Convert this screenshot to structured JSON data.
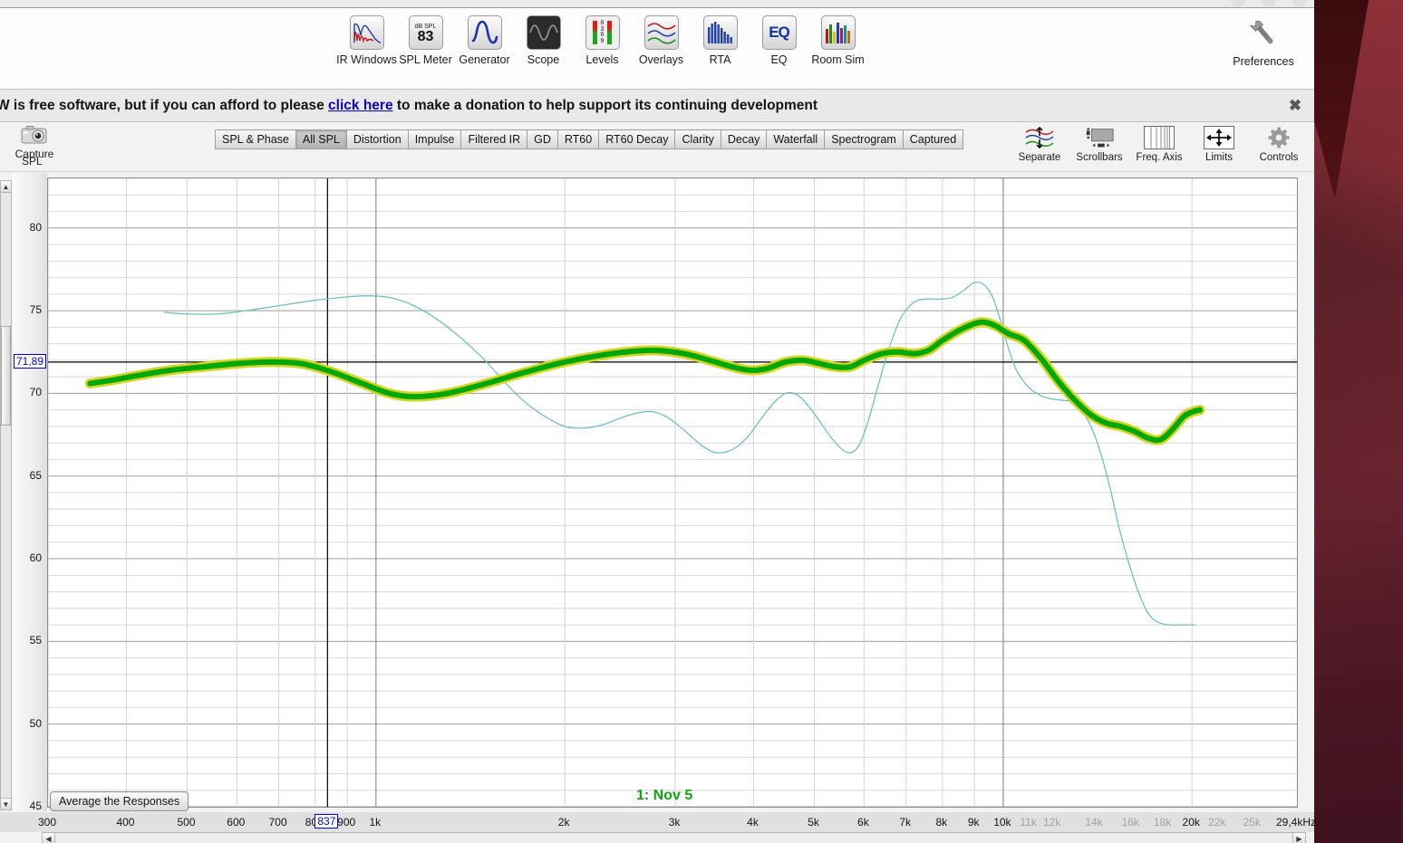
{
  "window": {
    "buttons": [
      "minimize",
      "maximize",
      "close"
    ]
  },
  "toolbar": {
    "items": [
      {
        "label": "IR Windows",
        "icon": "ir-windows-icon"
      },
      {
        "label": "SPL Meter",
        "icon": "spl-meter-icon",
        "value": "83",
        "unit": "dB SPL"
      },
      {
        "label": "Generator",
        "icon": "generator-icon"
      },
      {
        "label": "Scope",
        "icon": "scope-icon"
      },
      {
        "label": "Levels",
        "icon": "levels-icon",
        "scale": "0369"
      },
      {
        "label": "Overlays",
        "icon": "overlays-icon"
      },
      {
        "label": "RTA",
        "icon": "rta-icon"
      },
      {
        "label": "EQ",
        "icon": "eq-icon",
        "glyph": "EQ"
      },
      {
        "label": "Room Sim",
        "icon": "room-sim-icon"
      }
    ],
    "preferences": {
      "label": "Preferences",
      "icon": "wrench-icon"
    }
  },
  "banner": {
    "text_before": "W is free software, but if you can afford to please ",
    "link": "click here",
    "text_after": " to make a donation to help support its continuing development",
    "close": "✖"
  },
  "capture": {
    "label": "Capture",
    "icon": "camera-icon",
    "axis_label": "SPL"
  },
  "tabs": [
    {
      "label": "SPL & Phase",
      "active": false
    },
    {
      "label": "All SPL",
      "active": true
    },
    {
      "label": "Distortion",
      "active": false
    },
    {
      "label": "Impulse",
      "active": false
    },
    {
      "label": "Filtered IR",
      "active": false
    },
    {
      "label": "GD",
      "active": false
    },
    {
      "label": "RT60",
      "active": false
    },
    {
      "label": "RT60 Decay",
      "active": false
    },
    {
      "label": "Clarity",
      "active": false
    },
    {
      "label": "Decay",
      "active": false
    },
    {
      "label": "Waterfall",
      "active": false
    },
    {
      "label": "Spectrogram",
      "active": false
    },
    {
      "label": "Captured",
      "active": false
    }
  ],
  "right_tools": [
    {
      "label": "Separate",
      "icon": "separate-traces-icon"
    },
    {
      "label": "Scrollbars",
      "icon": "scrollbars-icon"
    },
    {
      "label": "Freq. Axis",
      "icon": "freq-axis-icon"
    },
    {
      "label": "Limits",
      "icon": "limits-icon"
    },
    {
      "label": "Controls",
      "icon": "controls-gear-icon"
    }
  ],
  "graph": {
    "average_button": "Average the Responses",
    "legend": "1: Nov 5",
    "cursor": {
      "y_value": "71,89",
      "x_value": "837"
    }
  },
  "chart_data": {
    "type": "line",
    "title": "",
    "xlabel": "",
    "ylabel": "SPL",
    "x_scale": "log",
    "xlim": [
      300,
      29400
    ],
    "ylim": [
      45,
      83
    ],
    "grid": true,
    "legend_position": "inside-bottom",
    "cursor_line_hz": 837,
    "cursor_line_db": 71.89,
    "y_ticks": [
      45,
      50,
      55,
      60,
      65,
      70,
      75,
      80
    ],
    "x_ticks": [
      {
        "label": "300",
        "hz": 300,
        "minor": false
      },
      {
        "label": "400",
        "hz": 400,
        "minor": false
      },
      {
        "label": "500",
        "hz": 500,
        "minor": false
      },
      {
        "label": "600",
        "hz": 600,
        "minor": false
      },
      {
        "label": "700",
        "hz": 700,
        "minor": false
      },
      {
        "label": "800",
        "hz": 800,
        "minor": false
      },
      {
        "label": "900",
        "hz": 900,
        "minor": false
      },
      {
        "label": "1k",
        "hz": 1000,
        "minor": false
      },
      {
        "label": "2k",
        "hz": 2000,
        "minor": false
      },
      {
        "label": "3k",
        "hz": 3000,
        "minor": false
      },
      {
        "label": "4k",
        "hz": 4000,
        "minor": false
      },
      {
        "label": "5k",
        "hz": 5000,
        "minor": false
      },
      {
        "label": "6k",
        "hz": 6000,
        "minor": false
      },
      {
        "label": "7k",
        "hz": 7000,
        "minor": false
      },
      {
        "label": "8k",
        "hz": 8000,
        "minor": false
      },
      {
        "label": "9k",
        "hz": 9000,
        "minor": false
      },
      {
        "label": "10k",
        "hz": 10000,
        "minor": false
      },
      {
        "label": "11k",
        "hz": 11000,
        "minor": true
      },
      {
        "label": "12k",
        "hz": 12000,
        "minor": true
      },
      {
        "label": "14k",
        "hz": 14000,
        "minor": true
      },
      {
        "label": "16k",
        "hz": 16000,
        "minor": true
      },
      {
        "label": "18k",
        "hz": 18000,
        "minor": true
      },
      {
        "label": "20k",
        "hz": 20000,
        "minor": false
      },
      {
        "label": "22k",
        "hz": 22000,
        "minor": true
      },
      {
        "label": "25k",
        "hz": 25000,
        "minor": true
      },
      {
        "label": "29,4kHz",
        "hz": 29400,
        "minor": false
      }
    ],
    "series": [
      {
        "name": "1: Nov 5",
        "color": "#00a806",
        "halo_color": "#d6d41e",
        "width": 6,
        "points": [
          [
            350,
            70.6
          ],
          [
            380,
            70.8
          ],
          [
            420,
            71.1
          ],
          [
            470,
            71.4
          ],
          [
            530,
            71.6
          ],
          [
            600,
            71.8
          ],
          [
            680,
            71.9
          ],
          [
            760,
            71.8
          ],
          [
            850,
            71.3
          ],
          [
            950,
            70.6
          ],
          [
            1050,
            70.0
          ],
          [
            1150,
            69.8
          ],
          [
            1300,
            70.0
          ],
          [
            1500,
            70.6
          ],
          [
            1700,
            71.2
          ],
          [
            1950,
            71.8
          ],
          [
            2200,
            72.2
          ],
          [
            2500,
            72.5
          ],
          [
            2800,
            72.6
          ],
          [
            3100,
            72.4
          ],
          [
            3400,
            72.0
          ],
          [
            3700,
            71.6
          ],
          [
            3950,
            71.4
          ],
          [
            4200,
            71.5
          ],
          [
            4500,
            71.9
          ],
          [
            4800,
            72.0
          ],
          [
            5100,
            71.8
          ],
          [
            5400,
            71.6
          ],
          [
            5700,
            71.6
          ],
          [
            6000,
            72.0
          ],
          [
            6400,
            72.4
          ],
          [
            6800,
            72.5
          ],
          [
            7200,
            72.4
          ],
          [
            7600,
            72.6
          ],
          [
            8000,
            73.2
          ],
          [
            8600,
            73.9
          ],
          [
            9200,
            74.3
          ],
          [
            9700,
            74.1
          ],
          [
            10200,
            73.6
          ],
          [
            10800,
            73.2
          ],
          [
            11500,
            72.1
          ],
          [
            12200,
            70.8
          ],
          [
            13000,
            69.6
          ],
          [
            13800,
            68.7
          ],
          [
            14600,
            68.2
          ],
          [
            15400,
            68.0
          ],
          [
            16200,
            67.7
          ],
          [
            17000,
            67.3
          ],
          [
            17800,
            67.2
          ],
          [
            18600,
            67.8
          ],
          [
            19400,
            68.6
          ],
          [
            20100,
            68.9
          ],
          [
            20600,
            69.0
          ]
        ]
      },
      {
        "name": "measurement-trace",
        "color": "#6ec0c4",
        "width": 1.3,
        "points": [
          [
            460,
            74.9
          ],
          [
            500,
            74.8
          ],
          [
            560,
            74.8
          ],
          [
            620,
            75.0
          ],
          [
            700,
            75.3
          ],
          [
            790,
            75.6
          ],
          [
            880,
            75.8
          ],
          [
            960,
            75.9
          ],
          [
            1050,
            75.8
          ],
          [
            1150,
            75.3
          ],
          [
            1260,
            74.4
          ],
          [
            1380,
            73.2
          ],
          [
            1500,
            71.9
          ],
          [
            1620,
            70.5
          ],
          [
            1750,
            69.3
          ],
          [
            1880,
            68.5
          ],
          [
            2000,
            68.0
          ],
          [
            2150,
            67.9
          ],
          [
            2300,
            68.1
          ],
          [
            2450,
            68.5
          ],
          [
            2600,
            68.8
          ],
          [
            2750,
            68.9
          ],
          [
            2900,
            68.6
          ],
          [
            3050,
            68.0
          ],
          [
            3200,
            67.3
          ],
          [
            3350,
            66.7
          ],
          [
            3500,
            66.4
          ],
          [
            3700,
            66.6
          ],
          [
            3900,
            67.3
          ],
          [
            4100,
            68.4
          ],
          [
            4300,
            69.4
          ],
          [
            4500,
            70.0
          ],
          [
            4700,
            69.9
          ],
          [
            4900,
            69.2
          ],
          [
            5100,
            68.3
          ],
          [
            5300,
            67.4
          ],
          [
            5500,
            66.7
          ],
          [
            5700,
            66.4
          ],
          [
            5900,
            66.9
          ],
          [
            6100,
            68.4
          ],
          [
            6300,
            70.3
          ],
          [
            6500,
            72.1
          ],
          [
            6700,
            73.6
          ],
          [
            6900,
            74.7
          ],
          [
            7200,
            75.5
          ],
          [
            7500,
            75.7
          ],
          [
            7900,
            75.7
          ],
          [
            8300,
            75.8
          ],
          [
            8700,
            76.3
          ],
          [
            9000,
            76.7
          ],
          [
            9300,
            76.6
          ],
          [
            9600,
            75.9
          ],
          [
            9900,
            74.4
          ],
          [
            10200,
            72.7
          ],
          [
            10500,
            71.4
          ],
          [
            10900,
            70.5
          ],
          [
            11300,
            70.0
          ],
          [
            11800,
            69.7
          ],
          [
            12300,
            69.6
          ],
          [
            12800,
            69.5
          ],
          [
            13300,
            69.0
          ],
          [
            13800,
            68.0
          ],
          [
            14300,
            66.4
          ],
          [
            14800,
            64.3
          ],
          [
            15300,
            61.9
          ],
          [
            15900,
            59.6
          ],
          [
            16500,
            57.8
          ],
          [
            17100,
            56.6
          ],
          [
            17800,
            56.1
          ],
          [
            18600,
            56.0
          ],
          [
            19400,
            56.0
          ],
          [
            20200,
            56.0
          ]
        ]
      }
    ]
  }
}
